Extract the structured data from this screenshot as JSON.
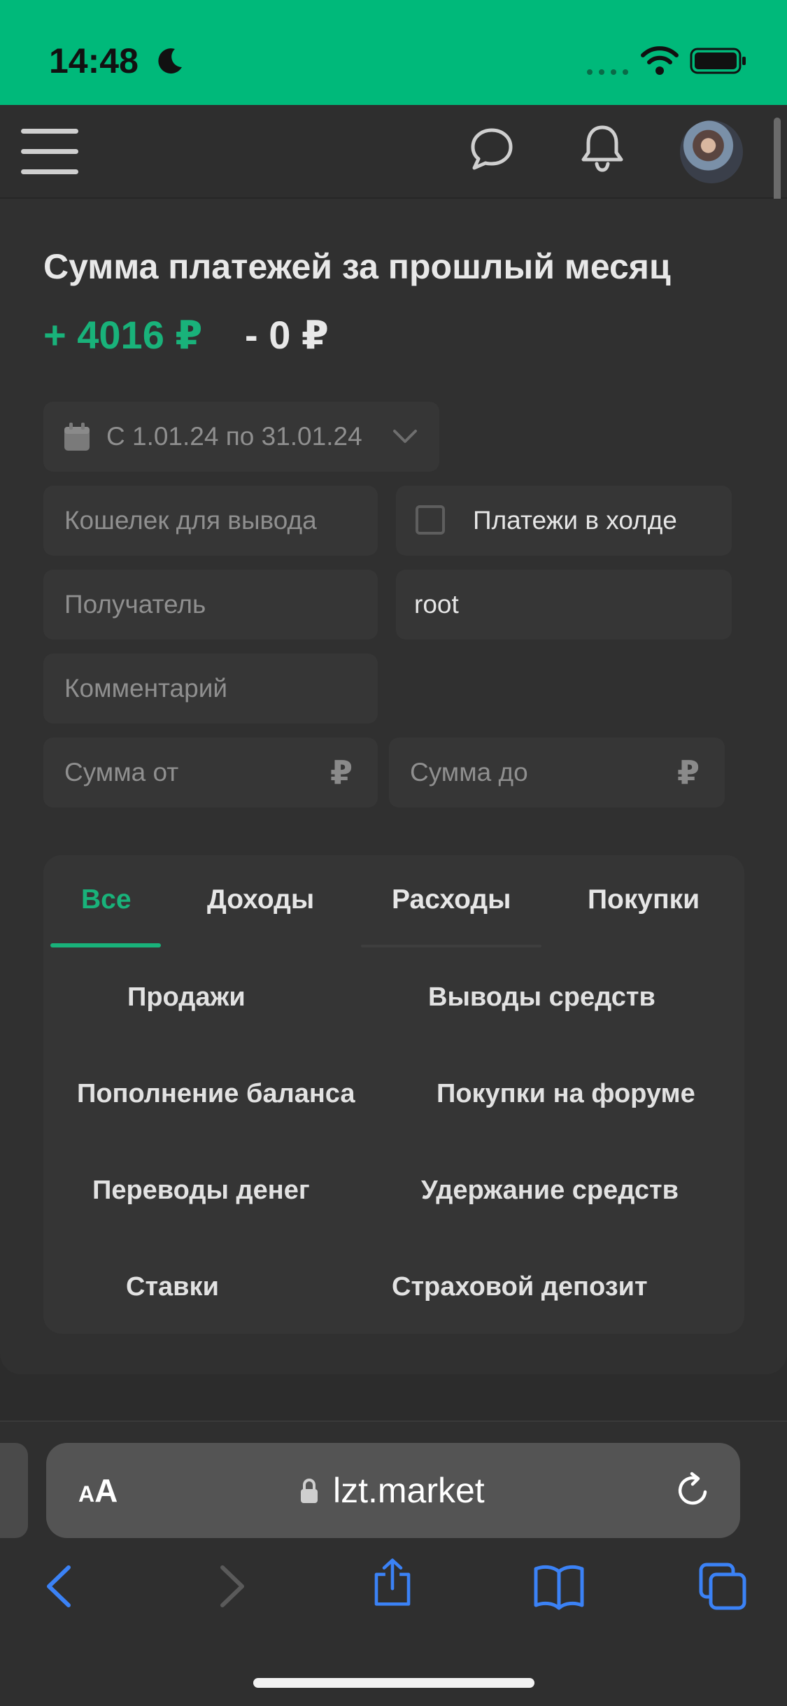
{
  "status_bar": {
    "time": "14:48"
  },
  "summary": {
    "title": "Сумма платежей за прошлый месяц",
    "income": "+ 4016 ₽",
    "expense": "- 0 ₽"
  },
  "filters": {
    "date_range": "С 1.01.24 по 31.01.24",
    "wallet_placeholder": "Кошелек для вывода",
    "hold_checkbox_label": "Платежи в холде",
    "recipient_placeholder": "Получатель",
    "user_value": "root",
    "comment_placeholder": "Комментарий",
    "amount_from_placeholder": "Сумма от",
    "amount_to_placeholder": "Сумма до",
    "currency_symbol": "₽"
  },
  "tabs": [
    "Все",
    "Доходы",
    "Расходы",
    "Покупки"
  ],
  "active_tab": "Все",
  "categories": [
    "Продажи",
    "Выводы средств",
    "Пополнение баланса",
    "Покупки на форуме",
    "Переводы денег",
    "Удержание средств",
    "Ставки",
    "Страховой депозит"
  ],
  "browser": {
    "text_size_small": "A",
    "text_size_large": "A",
    "domain": "lzt.market"
  },
  "colors": {
    "accent": "#19b27a",
    "status_bar": "#00b97a",
    "background": "#303030",
    "safari_blue": "#3b82f6"
  }
}
